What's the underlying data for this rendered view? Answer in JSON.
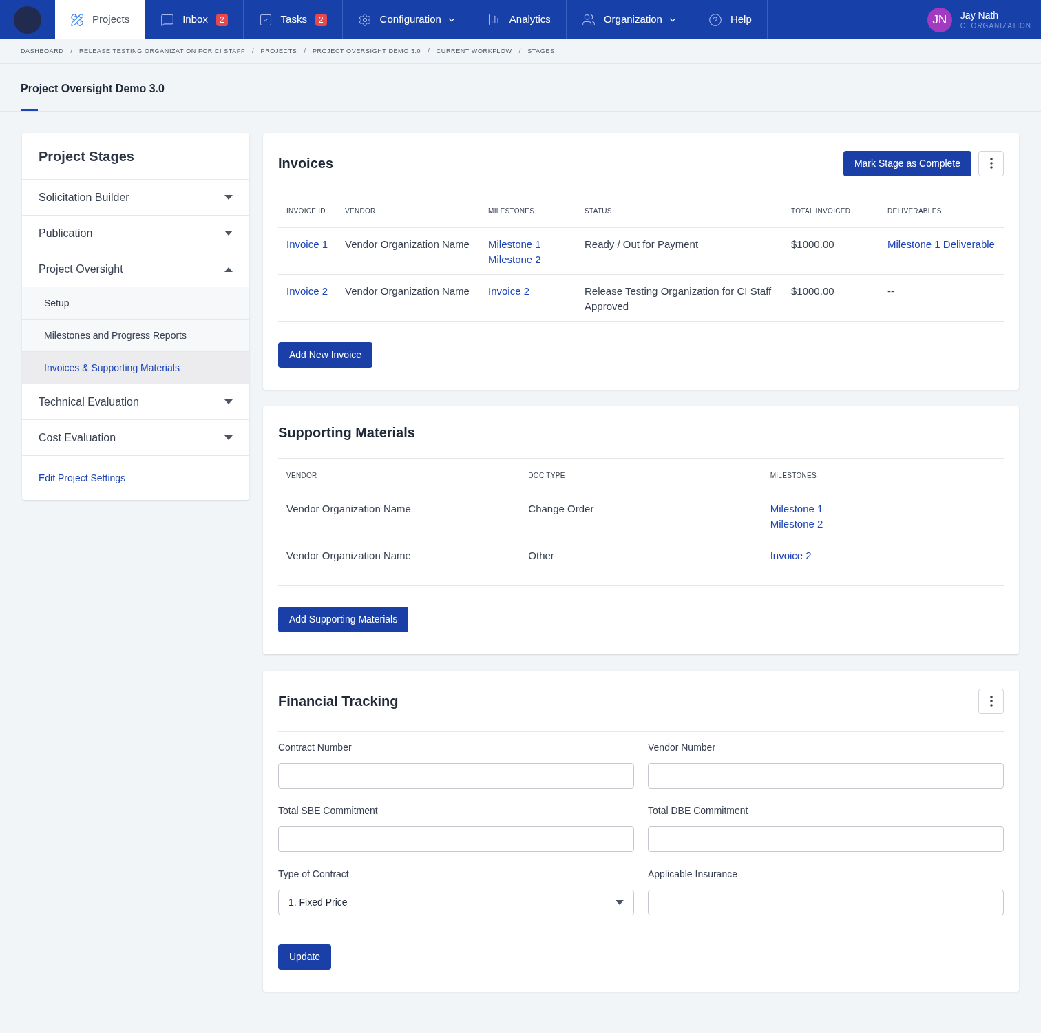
{
  "nav": {
    "tabs": [
      {
        "label": "Projects",
        "selected": true,
        "has_menu": false
      },
      {
        "label": "Inbox",
        "selected": false,
        "badge": "2",
        "has_menu": false
      },
      {
        "label": "Tasks",
        "selected": false,
        "badge": "2",
        "has_menu": false
      },
      {
        "label": "Configuration",
        "selected": false,
        "has_menu": true
      },
      {
        "label": "Analytics",
        "selected": false,
        "has_menu": false
      },
      {
        "label": "Organization",
        "selected": false,
        "has_menu": true
      },
      {
        "label": "Help",
        "selected": false,
        "has_menu": false
      }
    ],
    "user": {
      "initials": "JN",
      "name": "Jay Nath",
      "org": "CI ORGANIZATION"
    }
  },
  "breadcrumb_separator": "/",
  "breadcrumbs": [
    "DASHBOARD",
    "RELEASE TESTING ORGANIZATION FOR CI STAFF",
    "PROJECTS",
    "PROJECT OVERSIGHT DEMO 3.0",
    "CURRENT WORKFLOW",
    "STAGES"
  ],
  "page_title": "Project Oversight Demo 3.0",
  "sidebar": {
    "title": "Project Stages",
    "stages": [
      {
        "label": "Solicitation Builder",
        "expanded": false
      },
      {
        "label": "Publication",
        "expanded": false
      },
      {
        "label": "Project Oversight",
        "expanded": true,
        "children": [
          {
            "label": "Setup",
            "selected": false
          },
          {
            "label": "Milestones and Progress Reports",
            "selected": false
          },
          {
            "label": "Invoices & Supporting Materials",
            "selected": true
          }
        ]
      },
      {
        "label": "Technical Evaluation",
        "expanded": false
      },
      {
        "label": "Cost Evaluation",
        "expanded": false
      }
    ],
    "settings_link": "Edit Project Settings"
  },
  "invoices": {
    "title": "Invoices",
    "action": "Mark Stage as Complete",
    "columns": [
      "INVOICE ID",
      "VENDOR",
      "MILESTONES",
      "STATUS",
      "TOTAL INVOICED",
      "DELIVERABLES"
    ],
    "rows": [
      [
        {
          "kind": "link",
          "lines": [
            "Invoice 1"
          ]
        },
        {
          "kind": "text",
          "lines": [
            "Vendor Organization Name"
          ]
        },
        {
          "kind": "link",
          "lines": [
            "Milestone 1",
            "Milestone 2"
          ]
        },
        {
          "kind": "text",
          "lines": [
            "Ready / Out for Payment"
          ]
        },
        {
          "kind": "text",
          "lines": [
            "$1000.00"
          ]
        },
        {
          "kind": "link",
          "lines": [
            "Milestone 1 Deliverable"
          ]
        }
      ],
      [
        {
          "kind": "link",
          "lines": [
            "Invoice 2"
          ]
        },
        {
          "kind": "text",
          "lines": [
            "Vendor Organization Name"
          ]
        },
        {
          "kind": "link",
          "lines": [
            "Invoice 2"
          ]
        },
        {
          "kind": "text",
          "lines": [
            "Release Testing Organization for CI Staff Approved"
          ]
        },
        {
          "kind": "text",
          "lines": [
            "$1000.00"
          ]
        },
        {
          "kind": "text",
          "lines": [
            "--"
          ]
        }
      ]
    ],
    "add_button": "Add New Invoice"
  },
  "supporting": {
    "title": "Supporting Materials",
    "columns": [
      "VENDOR",
      "DOC TYPE",
      "MILESTONES"
    ],
    "rows": [
      [
        {
          "kind": "text",
          "lines": [
            "Vendor Organization Name"
          ]
        },
        {
          "kind": "text",
          "lines": [
            "Change Order"
          ]
        },
        {
          "kind": "link",
          "lines": [
            "Milestone 1",
            "Milestone 2"
          ]
        }
      ],
      [
        {
          "kind": "text",
          "lines": [
            "Vendor Organization Name"
          ]
        },
        {
          "kind": "text",
          "lines": [
            "Other"
          ]
        },
        {
          "kind": "link",
          "lines": [
            "Invoice 2"
          ]
        }
      ]
    ],
    "add_button": "Add Supporting Materials"
  },
  "financial": {
    "title": "Financial Tracking",
    "fields": [
      {
        "label": "Contract Number",
        "kind": "input"
      },
      {
        "label": "Vendor Number",
        "kind": "input"
      },
      {
        "label": "Total SBE Commitment",
        "kind": "input"
      },
      {
        "label": "Total DBE Commitment",
        "kind": "input"
      },
      {
        "label": "Type of Contract",
        "kind": "select",
        "value": "1. Fixed Price"
      },
      {
        "label": "Applicable Insurance",
        "kind": "input"
      }
    ],
    "submit": "Update"
  }
}
